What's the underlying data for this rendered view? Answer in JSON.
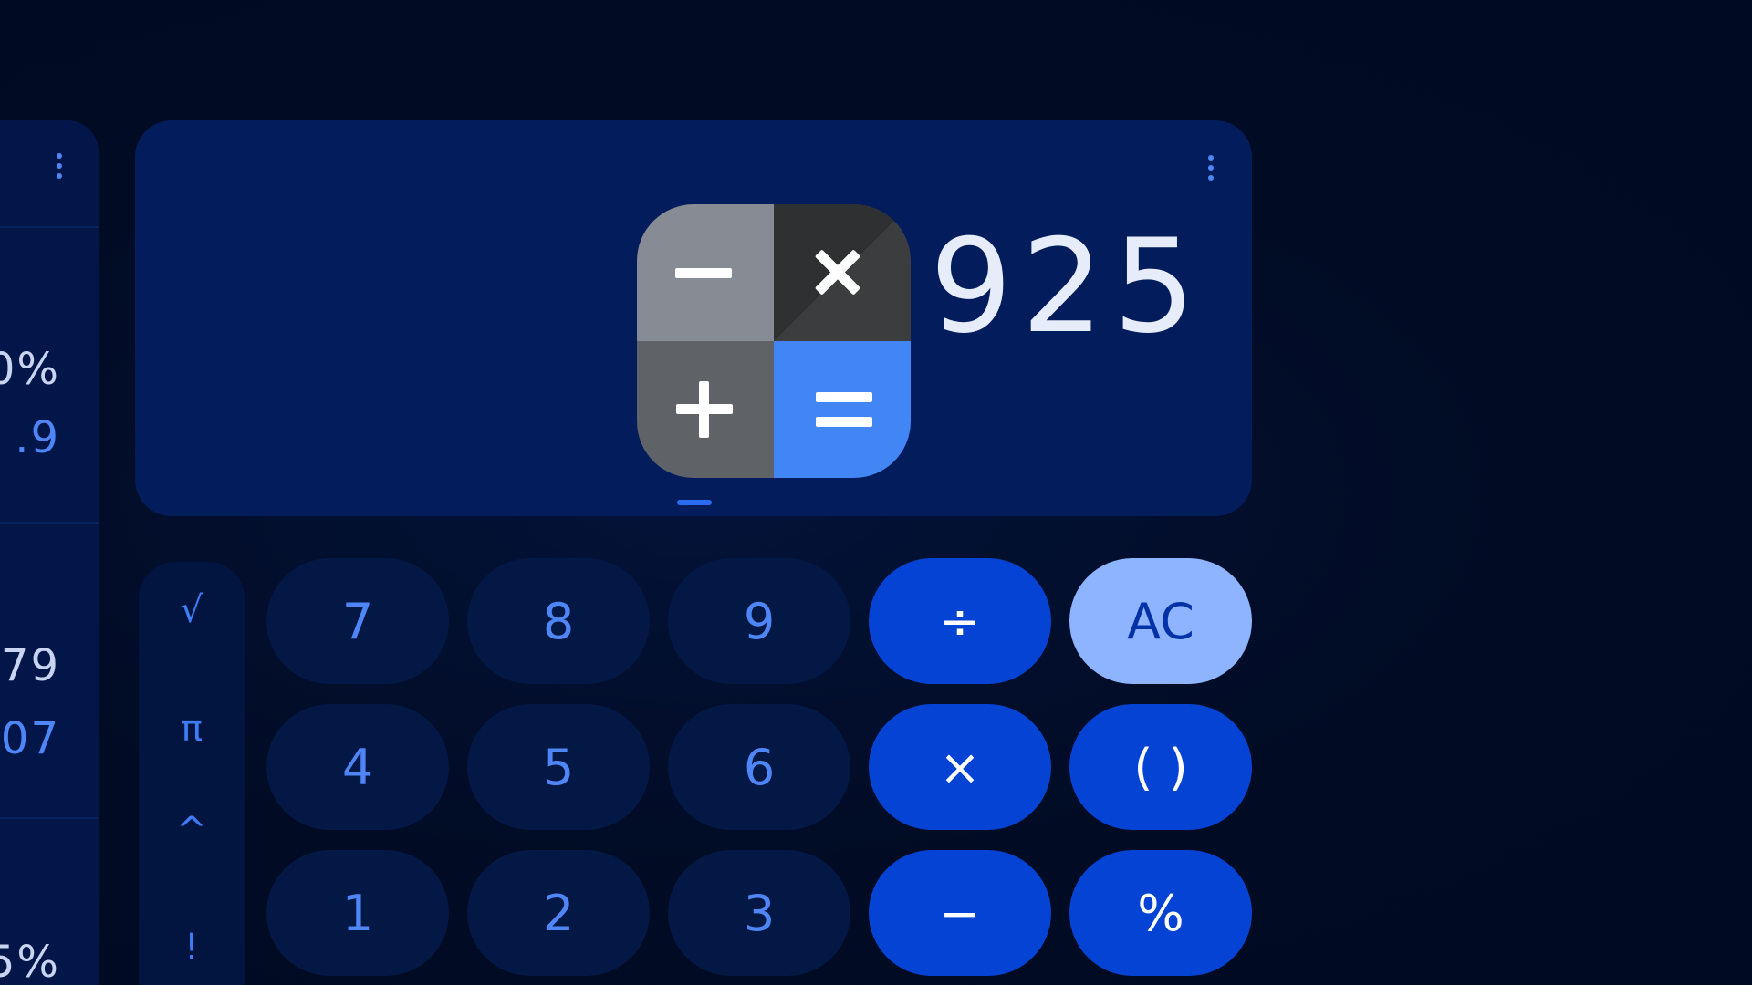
{
  "history": {
    "entries": [
      {
        "expression": "0%",
        "result": ".9"
      },
      {
        "expression": "79",
        "result": "07"
      },
      {
        "expression": "5%",
        "result": ""
      }
    ]
  },
  "display": {
    "value": "925"
  },
  "scientific_keys": [
    "√",
    "π",
    "^",
    "!"
  ],
  "keypad": {
    "row1": [
      "7",
      "8",
      "9",
      "÷",
      "AC"
    ],
    "row2": [
      "4",
      "5",
      "6",
      "×",
      "( )"
    ],
    "row3": [
      "1",
      "2",
      "3",
      "−",
      "%"
    ]
  },
  "colors": {
    "background": "#010b24",
    "display_card": "#031c5c",
    "number_key": "#031845",
    "operator_key": "#0443d3",
    "clear_key": "#8fb4ff",
    "accent_text": "#4f86f7"
  },
  "icons": {
    "menu": "more-vert-icon",
    "logo": "calculator-app-icon"
  }
}
